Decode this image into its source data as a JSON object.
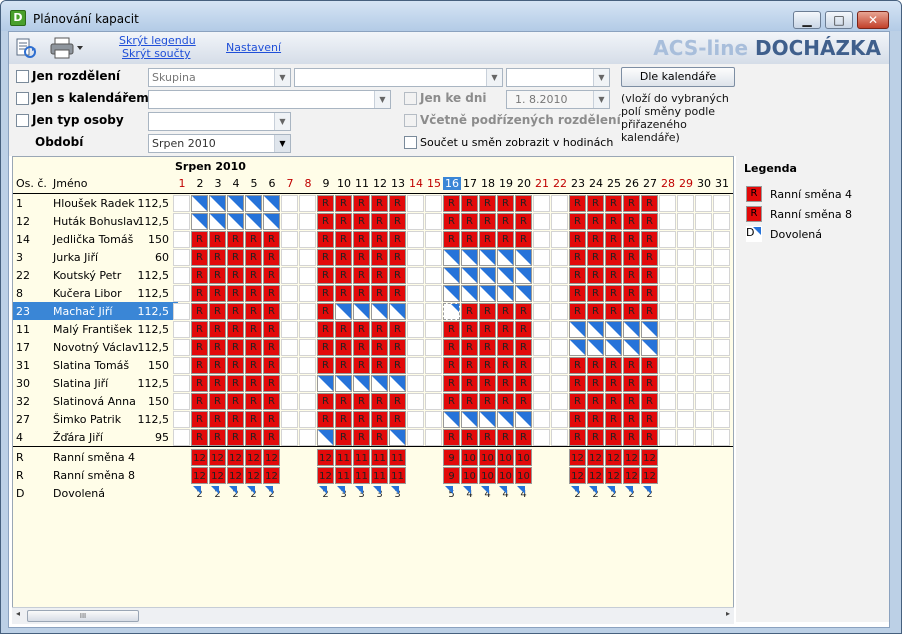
{
  "window": {
    "title": "Plánování kapacit",
    "min": "▁",
    "max": "□",
    "close": "✕"
  },
  "toolbar": {
    "hide_legend": "Skrýt legendu",
    "hide_sums": "Skrýt součty",
    "settings": "Nastavení",
    "brand1": "ACS-line",
    "brand2": "DOCHÁZKA"
  },
  "filters": {
    "jen_rozdeleni": "Jen rozdělení",
    "jen_s_kalendarem": "Jen s kalendářem",
    "jen_typ_osoby": "Jen typ osoby",
    "obdobi": "Období",
    "combo_skupina": "Skupina",
    "combo_obdobi": "Srpen 2010",
    "jen_ke_dni": "Jen ke dni",
    "date": "1. 8.2010",
    "vcetne": "Včetně podřízených rozdělení",
    "soucet": "Součet u směn zobrazit v hodinách",
    "dle_kalendare": "Dle kalendáře",
    "note": "(vloží do vybraných polí směny podle přiřazeného kalendáře)"
  },
  "grid": {
    "month": "Srpen  2010",
    "col_os": "Os. č.",
    "col_jmeno": "Jméno",
    "days": [
      "1",
      "2",
      "3",
      "4",
      "5",
      "6",
      "7",
      "8",
      "9",
      "10",
      "11",
      "12",
      "13",
      "14",
      "15",
      "16",
      "17",
      "18",
      "19",
      "20",
      "21",
      "22",
      "23",
      "24",
      "25",
      "26",
      "27",
      "28",
      "29",
      "30",
      "31"
    ],
    "weekend_days": [
      1,
      7,
      8,
      14,
      15,
      21,
      22,
      28,
      29
    ],
    "today_day": 16,
    "selected_row": 6,
    "employees": [
      {
        "os": "1",
        "name": "Hloušek Radek",
        "hours": "112,5",
        "shifts": "_DDDDD__RRRRR__RRRRR__RRRRR____"
      },
      {
        "os": "12",
        "name": "Huták Bohuslav",
        "hours": "112,5",
        "shifts": "_DDDDD__RRRRR__RRRRR__RRRRR____"
      },
      {
        "os": "14",
        "name": "Jedlička Tomáš",
        "hours": "150",
        "shifts": "_RRRRR__RRRRR__RRRRR__RRRRR____"
      },
      {
        "os": "3",
        "name": "Jurka Jiří",
        "hours": "60",
        "shifts": "_RRRRR__RRRRR__DDDDD__RRRRR____"
      },
      {
        "os": "22",
        "name": "Koutský Petr",
        "hours": "112,5",
        "shifts": "_RRRRR__RRRRR__DDDDD__RRRRR____"
      },
      {
        "os": "8",
        "name": "Kučera Libor",
        "hours": "112,5",
        "shifts": "_RRRRR__RRRRR__DDDDD__RRRRR____"
      },
      {
        "os": "23",
        "name": "Machač Jiří",
        "hours": "112,5",
        "shifts": "_RRRRR__RDDDD__dRRRR__RRRRR____"
      },
      {
        "os": "11",
        "name": "Malý František",
        "hours": "112,5",
        "shifts": "_RRRRR__RRRRR__RRRRR__DDDDD____"
      },
      {
        "os": "17",
        "name": "Novotný Václav",
        "hours": "112,5",
        "shifts": "_RRRRR__RRRRR__RRRRR__DDDDD____"
      },
      {
        "os": "31",
        "name": "Slatina Tomáš",
        "hours": "150",
        "shifts": "_RRRRR__RRRRR__RRRRR__RRRRR____"
      },
      {
        "os": "30",
        "name": "Slatina Jiří",
        "hours": "112,5",
        "shifts": "_RRRRR__DDDDD__RRRRR__RRRRR____"
      },
      {
        "os": "32",
        "name": "Slatinová Anna",
        "hours": "150",
        "shifts": "_RRRRR__RRRRR__RRRRR__RRRRR____"
      },
      {
        "os": "27",
        "name": "Šimko Patrik",
        "hours": "112,5",
        "shifts": "_RRRRR__RRRRR__DDDDD__RRRRR____"
      },
      {
        "os": "4",
        "name": "Žďára Jiří",
        "hours": "95",
        "shifts": "_RRRRR__DRRRD__RRRRR__RRRRR____"
      }
    ],
    "summary": [
      {
        "os": "R",
        "name": "Ranní směna 4",
        "kind": "R",
        "values": {
          "2": "12",
          "3": "12",
          "4": "12",
          "5": "12",
          "6": "12",
          "9": "12",
          "10": "11",
          "11": "11",
          "12": "11",
          "13": "11",
          "16": "9",
          "17": "10",
          "18": "10",
          "19": "10",
          "20": "10",
          "23": "12",
          "24": "12",
          "25": "12",
          "26": "12",
          "27": "12"
        }
      },
      {
        "os": "R",
        "name": "Ranní směna 8",
        "kind": "R",
        "values": {
          "2": "12",
          "3": "12",
          "4": "12",
          "5": "12",
          "6": "12",
          "9": "12",
          "10": "11",
          "11": "11",
          "12": "11",
          "13": "11",
          "16": "9",
          "17": "10",
          "18": "10",
          "19": "10",
          "20": "10",
          "23": "12",
          "24": "12",
          "25": "12",
          "26": "12",
          "27": "12"
        }
      },
      {
        "os": "D",
        "name": "Dovolená",
        "kind": "D",
        "values": {
          "2": "2",
          "3": "2",
          "4": "2",
          "5": "2",
          "6": "2",
          "9": "2",
          "10": "3",
          "11": "3",
          "12": "3",
          "13": "3",
          "16": "5",
          "17": "4",
          "18": "4",
          "19": "4",
          "20": "4",
          "23": "2",
          "24": "2",
          "25": "2",
          "26": "2",
          "27": "2"
        }
      }
    ]
  },
  "legend": {
    "title": "Legenda",
    "items": [
      {
        "code": "R",
        "label": "Ranní směna 4"
      },
      {
        "code": "R",
        "label": "Ranní směna 8"
      },
      {
        "code": "D",
        "label": "Dovolená"
      }
    ]
  },
  "scroll": {
    "thumb": "III",
    "left": "◂",
    "right": "▸"
  },
  "colors": {
    "shift_red": "#e20a0a",
    "vacation_blue": "#2673d9",
    "selection": "#3a86d6",
    "weekend_text": "#c00000"
  }
}
